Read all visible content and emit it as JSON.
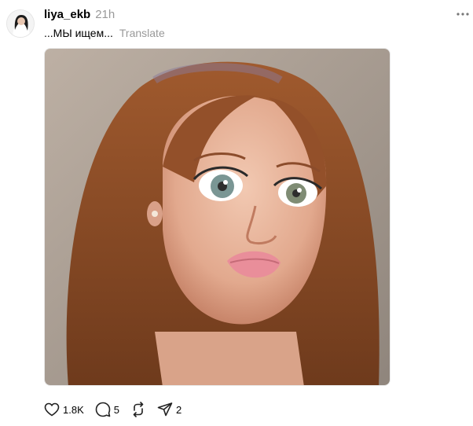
{
  "post": {
    "username": "liya_ekb",
    "time": "21h",
    "caption": "...МЫ ищем...",
    "translate_label": "Translate"
  },
  "actions": {
    "likes": "1.8K",
    "comments": "5",
    "shares": "2"
  },
  "icons": {
    "more": "more-icon",
    "like": "heart-icon",
    "comment": "comment-icon",
    "repost": "repost-icon",
    "share": "send-icon"
  }
}
